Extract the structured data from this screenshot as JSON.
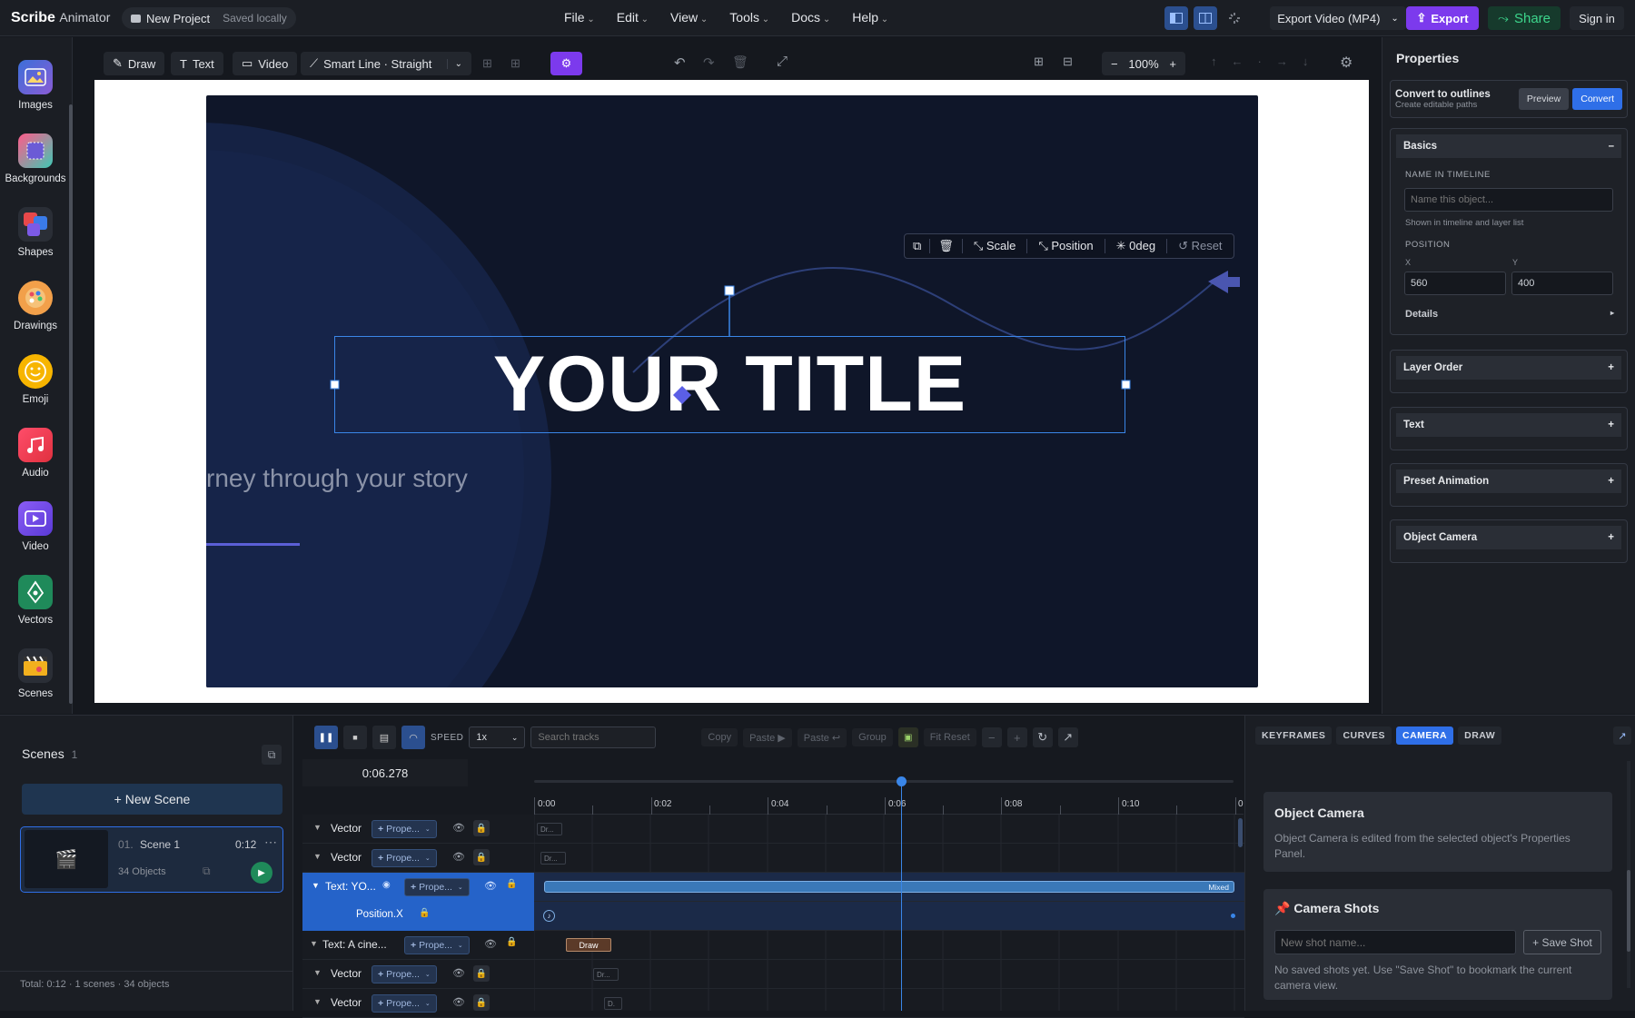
{
  "app": {
    "brand": "Scribe",
    "brand_sub": "Animator",
    "project": "New Project",
    "saved": "Saved locally"
  },
  "menu": [
    "File",
    "Edit",
    "View",
    "Tools",
    "Docs",
    "Help"
  ],
  "top_actions": {
    "export_format": "Export Video (MP4)",
    "export": "Export",
    "share": "Share",
    "signin": "Sign in"
  },
  "toolbar": {
    "draw": "Draw",
    "text": "Text",
    "video": "Video",
    "smart_line": "Smart Line · Straight",
    "zoom": "100%"
  },
  "rail": [
    {
      "label": "Images",
      "icon": "images-icon"
    },
    {
      "label": "Backgrounds",
      "icon": "backgrounds-icon"
    },
    {
      "label": "Shapes",
      "icon": "shapes-icon"
    },
    {
      "label": "Drawings",
      "icon": "drawings-icon"
    },
    {
      "label": "Emoji",
      "icon": "emoji-icon"
    },
    {
      "label": "Audio",
      "icon": "audio-icon"
    },
    {
      "label": "Video",
      "icon": "video-icon"
    },
    {
      "label": "Vectors",
      "icon": "vectors-icon"
    },
    {
      "label": "Scenes",
      "icon": "scenes-icon"
    }
  ],
  "canvas": {
    "title": "YOUR TITLE",
    "subtitle": "rney through your story",
    "float_toolbar": {
      "scale": "Scale",
      "position": "Position",
      "rotation": "0deg",
      "reset": "Reset"
    }
  },
  "properties": {
    "title": "Properties",
    "outline": {
      "title": "Convert to outlines",
      "sub": "Create editable paths",
      "preview": "Preview",
      "convert": "Convert"
    },
    "basics": {
      "title": "Basics",
      "collapse": "–",
      "name_label": "NAME IN TIMELINE",
      "name_placeholder": "Name this object...",
      "name_hint": "Shown in timeline and layer list",
      "position_label": "POSITION",
      "x_label": "X",
      "y_label": "Y",
      "x": "560",
      "y": "400",
      "details": "Details",
      "details_glyph": "▸"
    },
    "sections": [
      {
        "title": "Layer Order",
        "glyph": "+"
      },
      {
        "title": "Text",
        "glyph": "+"
      },
      {
        "title": "Preset Animation",
        "glyph": "+"
      },
      {
        "title": "Object Camera",
        "glyph": "+"
      }
    ]
  },
  "scenes": {
    "title": "Scenes",
    "count": "1",
    "new_scene": "+ New Scene",
    "items": [
      {
        "index": "01.",
        "name": "Scene 1",
        "duration": "0:12",
        "objects": "34 Objects"
      }
    ],
    "footer": "Total: 0:12 · 1 scenes · 34 objects"
  },
  "timeline": {
    "speed_label": "SPEED",
    "speed": "1x",
    "search_placeholder": "Search tracks",
    "actions": [
      "Copy",
      "Paste ▶",
      "Paste ↩",
      "Group",
      "Fit Reset"
    ],
    "time": "0:06.278",
    "ticks": [
      "0:00",
      "0:02",
      "0:04",
      "0:06",
      "0:08",
      "0:10",
      "0"
    ],
    "playhead_seconds": 6.278,
    "tracks": [
      {
        "name": "Vector",
        "chip": "Prope...",
        "clip": "Dr..."
      },
      {
        "name": "Vector",
        "chip": "Prope...",
        "clip": "Dr..."
      },
      {
        "name": "Text: YO...",
        "chip": "Prope...",
        "clip": "Mixed"
      },
      {
        "name": "Position.X",
        "chip": "",
        "clip": ""
      },
      {
        "name": "Text: A cine...",
        "chip": "Prope...",
        "clip": "Draw"
      },
      {
        "name": "Vector",
        "chip": "Prope...",
        "clip": "Dr..."
      },
      {
        "name": "Vector",
        "chip": "Prope...",
        "clip": "D."
      }
    ]
  },
  "camera_panel": {
    "tabs": [
      "KEYFRAMES",
      "CURVES",
      "CAMERA",
      "DRAW"
    ],
    "object_camera_title": "Object Camera",
    "object_camera_text": "Object Camera is edited from the selected object's Properties Panel.",
    "shots_title": "Camera Shots",
    "shot_placeholder": "New shot name...",
    "save_shot": "+ Save Shot",
    "empty_text": "No saved shots yet. Use \"Save Shot\" to bookmark the current camera view."
  },
  "colors": {
    "accent": "#2f6fe8",
    "purple": "#7c3aed",
    "green": "#1f8a5a",
    "slide_bg": "#0f1629"
  }
}
